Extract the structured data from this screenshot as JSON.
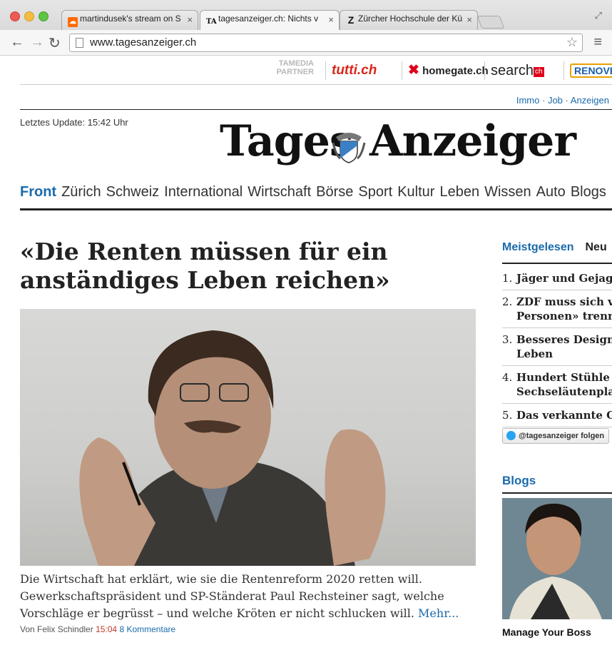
{
  "browser": {
    "tabs": [
      {
        "title": "martindusek's stream on S",
        "icon": "soundcloud-icon"
      },
      {
        "title": "tagesanzeiger.ch: Nichts v",
        "icon": "tagesanzeiger-icon"
      },
      {
        "title": "Zürcher Hochschule der Kü",
        "icon": "zhdk-icon"
      }
    ],
    "url": "www.tagesanzeiger.ch"
  },
  "partners": {
    "label_line1": "TAMEDIA",
    "label_line2": "PARTNER",
    "items": [
      "tutti.ch",
      "homegate.ch",
      "search",
      "ch",
      "RENOVE"
    ]
  },
  "toplinks": {
    "immo": "Immo",
    "job": "Job",
    "anzeigen": "Anzeigen"
  },
  "update": "Letztes Update: 15:42 Uhr",
  "logo": {
    "left": "Tages",
    "right": "Anzeiger"
  },
  "nav": [
    "Front",
    "Zürich",
    "Schweiz",
    "International",
    "Wirtschaft",
    "Börse",
    "Sport",
    "Kultur",
    "Leben",
    "Wissen",
    "Auto",
    "Blogs"
  ],
  "article": {
    "headline": "«Die Renten müssen für ein anständiges Leben reichen»",
    "teaser": "Die Wirtschaft hat erklärt, wie sie die Rentenreform 2020 retten will. Gewerkschaftspräsident und SP-Ständerat Paul Rechsteiner sagt, welche Vorschläge er begrüsst – und welche Kröten er nicht schlucken will.",
    "more": "Mehr...",
    "author": "Von Felix Schindler",
    "time": "15:04",
    "comments": "8 Kommentare"
  },
  "sidebar": {
    "tab_most_read": "Meistgelesen",
    "tab_new": "Neu",
    "most_read": [
      {
        "num": "1.",
        "line1": "Jäger und Gejagt",
        "line2": ""
      },
      {
        "num": "2.",
        "line1": "ZDF muss sich vo",
        "line2": "Personen» trenn"
      },
      {
        "num": "3.",
        "line1": "Besseres Design",
        "line2": "Leben"
      },
      {
        "num": "4.",
        "line1": "Hundert Stühle f",
        "line2": "Sechseläutenpla"
      },
      {
        "num": "5.",
        "line1": "Das verkannte G",
        "line2": ""
      }
    ],
    "twitter": "@tagesanzeiger folgen",
    "blogs_title": "Blogs",
    "blog_caption": "Manage Your Boss"
  }
}
